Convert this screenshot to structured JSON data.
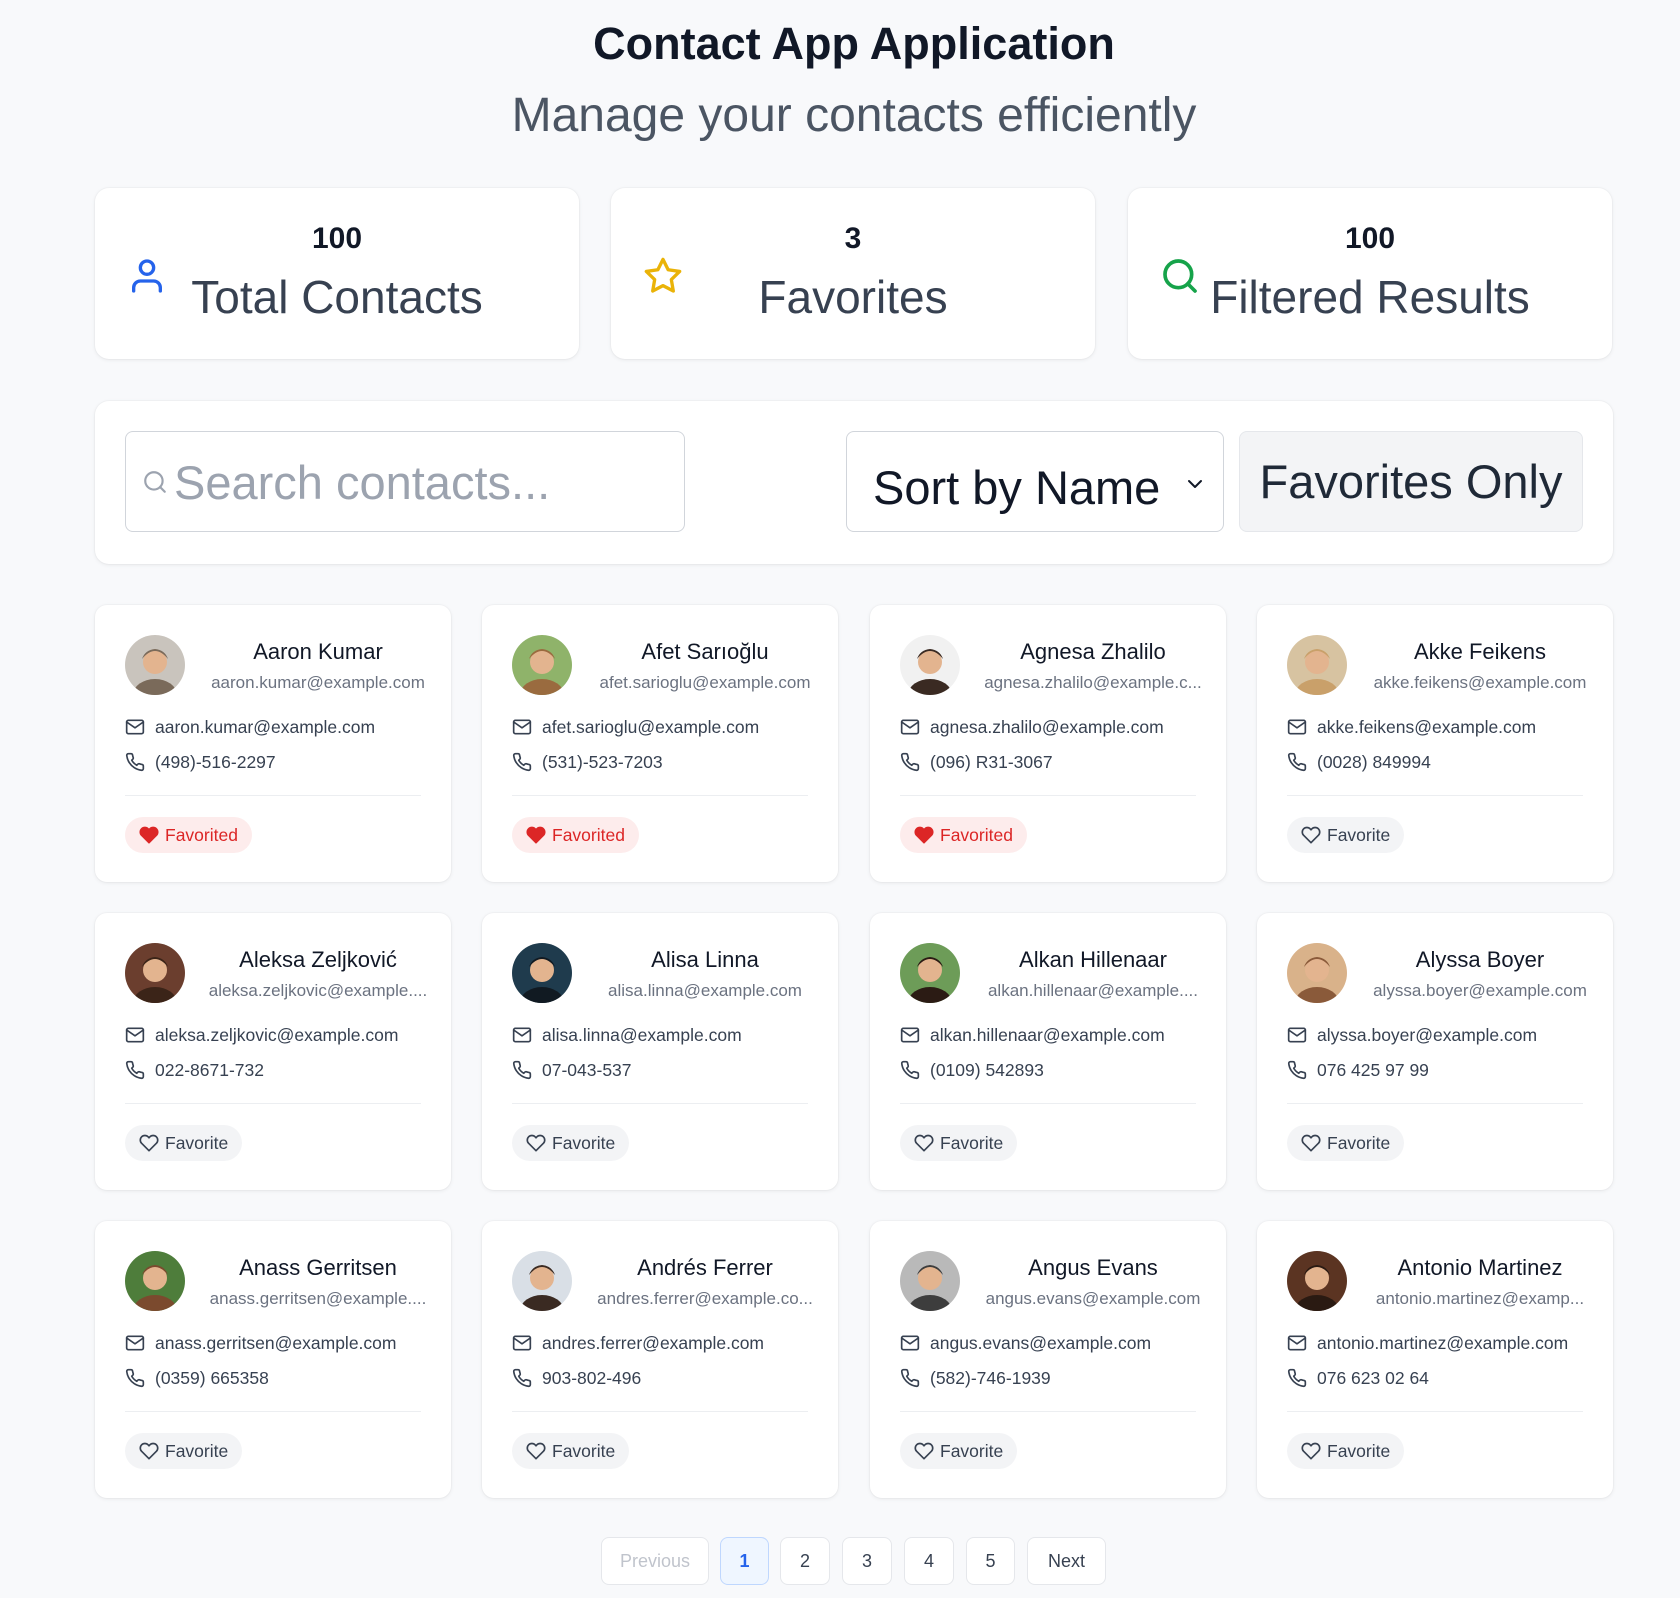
{
  "header": {
    "title": "Contact App Application",
    "subtitle": "Manage your contacts efficiently"
  },
  "stats": [
    {
      "value": "100",
      "label": "Total Contacts",
      "icon": "user-icon",
      "color": "#2563eb"
    },
    {
      "value": "3",
      "label": "Favorites",
      "icon": "star-icon",
      "color": "#eab308"
    },
    {
      "value": "100",
      "label": "Filtered Results",
      "icon": "search-icon",
      "color": "#16a34a"
    }
  ],
  "toolbar": {
    "search_placeholder": "Search contacts...",
    "sort_label": "Sort by Name",
    "favorites_only_label": "Favorites Only"
  },
  "contacts": [
    {
      "name": "Aaron Kumar",
      "sub_email": "aaron.kumar@example.com",
      "email": "aaron.kumar@example.com",
      "phone": "(498)-516-2297",
      "favorite": true,
      "favorite_label": "Favorited"
    },
    {
      "name": "Afet Sarıoğlu",
      "sub_email": "afet.sarioglu@example.com",
      "email": "afet.sarioglu@example.com",
      "phone": "(531)-523-7203",
      "favorite": true,
      "favorite_label": "Favorited"
    },
    {
      "name": "Agnesa Zhalilo",
      "sub_email": "agnesa.zhalilo@example.c...",
      "email": "agnesa.zhalilo@example.com",
      "phone": "(096) R31-3067",
      "favorite": true,
      "favorite_label": "Favorited"
    },
    {
      "name": "Akke Feikens",
      "sub_email": "akke.feikens@example.com",
      "email": "akke.feikens@example.com",
      "phone": "(0028) 849994",
      "favorite": false,
      "favorite_label": "Favorite"
    },
    {
      "name": "Aleksa Zeljković",
      "sub_email": "aleksa.zeljkovic@example....",
      "email": "aleksa.zeljkovic@example.com",
      "phone": "022-8671-732",
      "favorite": false,
      "favorite_label": "Favorite"
    },
    {
      "name": "Alisa Linna",
      "sub_email": "alisa.linna@example.com",
      "email": "alisa.linna@example.com",
      "phone": "07-043-537",
      "favorite": false,
      "favorite_label": "Favorite"
    },
    {
      "name": "Alkan Hillenaar",
      "sub_email": "alkan.hillenaar@example....",
      "email": "alkan.hillenaar@example.com",
      "phone": "(0109) 542893",
      "favorite": false,
      "favorite_label": "Favorite"
    },
    {
      "name": "Alyssa Boyer",
      "sub_email": "alyssa.boyer@example.com",
      "email": "alyssa.boyer@example.com",
      "phone": "076 425 97 99",
      "favorite": false,
      "favorite_label": "Favorite"
    },
    {
      "name": "Anass Gerritsen",
      "sub_email": "anass.gerritsen@example....",
      "email": "anass.gerritsen@example.com",
      "phone": "(0359) 665358",
      "favorite": false,
      "favorite_label": "Favorite"
    },
    {
      "name": "Andrés Ferrer",
      "sub_email": "andres.ferrer@example.co...",
      "email": "andres.ferrer@example.com",
      "phone": "903-802-496",
      "favorite": false,
      "favorite_label": "Favorite"
    },
    {
      "name": "Angus Evans",
      "sub_email": "angus.evans@example.com",
      "email": "angus.evans@example.com",
      "phone": "(582)-746-1939",
      "favorite": false,
      "favorite_label": "Favorite"
    },
    {
      "name": "Antonio Martinez",
      "sub_email": "antonio.martinez@examp...",
      "email": "antonio.martinez@example.com",
      "phone": "076 623 02 64",
      "favorite": false,
      "favorite_label": "Favorite"
    }
  ],
  "pagination": {
    "previous_label": "Previous",
    "pages": [
      "1",
      "2",
      "3",
      "4",
      "5"
    ],
    "current_page": "1",
    "next_label": "Next"
  },
  "colors": {
    "accent": "#2563eb",
    "favorite": "#dc2626",
    "favorite_bg": "#fdecec",
    "star": "#eab308",
    "search_stat": "#16a34a"
  }
}
